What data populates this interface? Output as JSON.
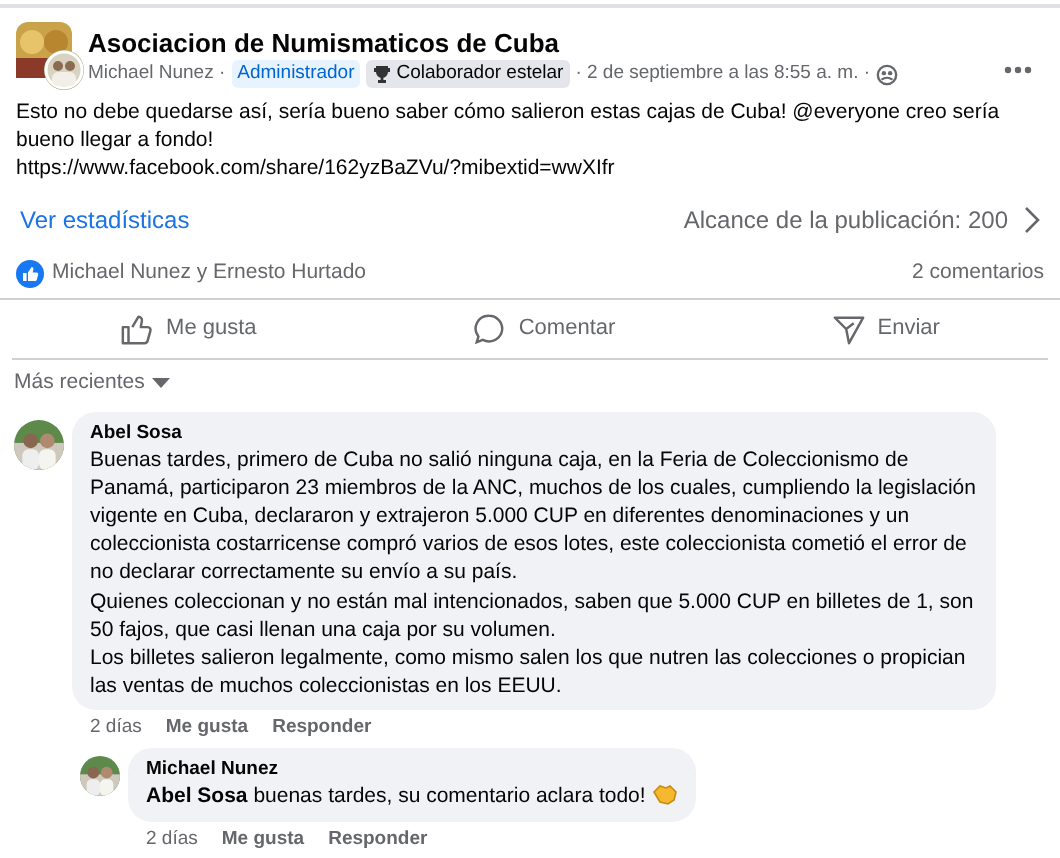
{
  "post": {
    "group": "Asociacion de Numismaticos de Cuba",
    "author": "Michael Nunez ·",
    "badges": [
      {
        "label": "Administrador",
        "kind": "role"
      },
      {
        "label": "Colaborador estelar",
        "kind": "award"
      }
    ],
    "time": "· 2 de septiembre a las 8:55 a. m. ·",
    "text": "Esto no debe quedarse así, sería bueno saber cómo salieron estas cajas de Cuba! @everyone creo sería bueno llegar a fondo!",
    "link": "https://www.facebook.com/share/162yzBaZVu/?mibextid=wwXIfr"
  },
  "insights": {
    "link": "Ver estadísticas",
    "reach": "Alcance de la publicación: 200"
  },
  "reactions": {
    "names": "Michael Nunez y Ernesto Hurtado",
    "comments": "2 comentarios"
  },
  "actions": [
    {
      "label": "Me gusta",
      "kind": "like"
    },
    {
      "label": "Comentar",
      "kind": "comment"
    },
    {
      "label": "Enviar",
      "kind": "share"
    }
  ],
  "sort": "Más recientes",
  "comments": [
    {
      "author": "Abel Sosa",
      "paragraphs": [
        "Buenas tardes, primero de Cuba no salió ninguna caja, en la Feria de Coleccionismo de Panamá, participaron 23 miembros de la ANC, muchos de los cuales, cumpliendo la legislación vigente en Cuba, declararon y extrajeron 5.000 CUP en diferentes denominaciones y un coleccionista costarricense compró varios de esos lotes, este coleccionista cometió el error de no declarar correctamente su envío a su país.",
        "Quienes coleccionan y no están mal intencionados, saben que 5.000 CUP en billetes de 1, son 50 fajos, que casi llenan una caja por su volumen.",
        "Los billetes salieron legalmente, como mismo salen los que nutren las colecciones o propician las ventas de muchos coleccionistas en los EEUU."
      ],
      "time": "2 días",
      "like": "Me gusta",
      "reply": "Responder",
      "replies": [
        {
          "author": "Michael Nunez",
          "paragraphs": [
            "**Abel Sosa** buenas tardes, su comentario aclara todo!"
          ],
          "emoji": true,
          "time": "2 días",
          "like": "Me gusta",
          "reply": "Responder"
        }
      ]
    }
  ]
}
